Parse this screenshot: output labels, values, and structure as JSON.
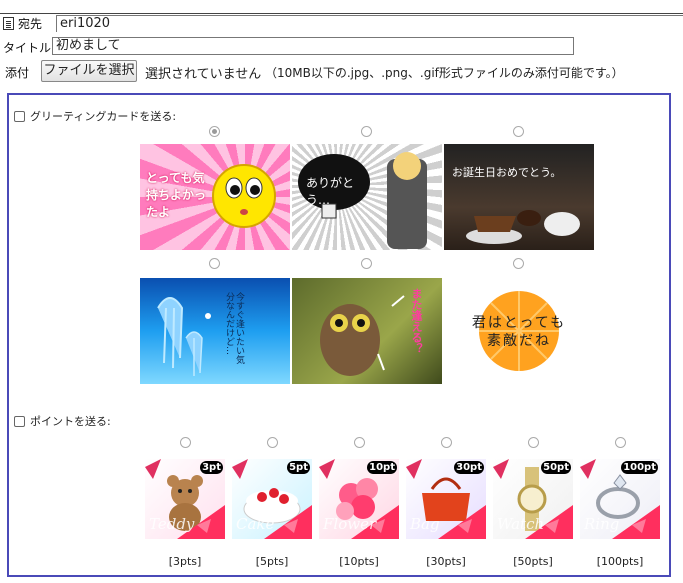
{
  "compose": {
    "to_label": "宛先",
    "to_value": "eri1020",
    "title_label": "タイトル",
    "title_value": "初めまして",
    "attach_label": "添付",
    "file_button": "ファイルを選択",
    "file_status": "選択されていません",
    "file_note": "（10MB以下の.jpg、.png、.gif形式ファイルのみ添付可能です。）"
  },
  "greeting": {
    "label": "グリーティングカードを送る:",
    "cards": [
      {
        "text": "とっても気持ちよかったよ",
        "selected": true
      },
      {
        "text": "ありがとう…",
        "selected": false
      },
      {
        "text": "お誕生日おめでとう。",
        "selected": false
      },
      {
        "text": "今すぐ逢いたい気分なんだけど…",
        "selected": false
      },
      {
        "text": "また逢える？",
        "selected": false
      },
      {
        "text": "君はとっても素敵だね",
        "selected": false
      }
    ]
  },
  "points": {
    "label": "ポイントを送る:",
    "items": [
      {
        "badge": "3pt",
        "caption": "[3pts]",
        "script": "Teddy"
      },
      {
        "badge": "5pt",
        "caption": "[5pts]",
        "script": "Cake"
      },
      {
        "badge": "10pt",
        "caption": "[10pts]",
        "script": "Flower"
      },
      {
        "badge": "30pt",
        "caption": "[30pts]",
        "script": "Bag"
      },
      {
        "badge": "50pt",
        "caption": "[50pts]",
        "script": "Watch"
      },
      {
        "badge": "100pt",
        "caption": "[100pts]",
        "script": "Ring"
      }
    ]
  },
  "colors": {
    "panel_border": "#4a4ab8"
  }
}
